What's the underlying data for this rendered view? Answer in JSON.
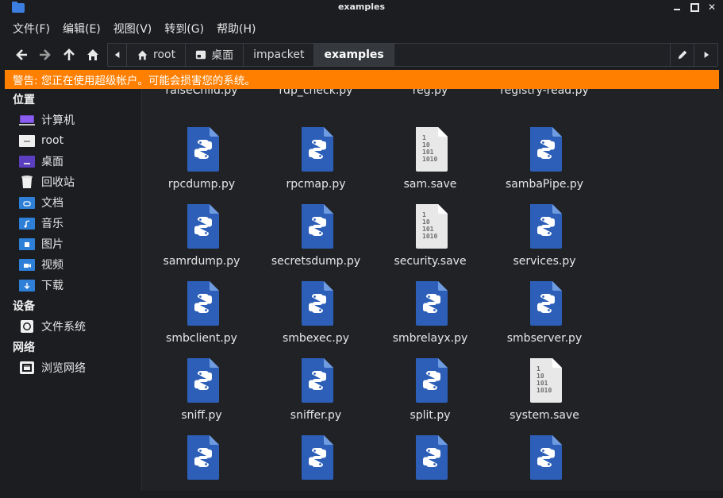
{
  "window": {
    "title": "examples"
  },
  "menu": [
    {
      "label": "文件(F)"
    },
    {
      "label": "编辑(E)"
    },
    {
      "label": "视图(V)"
    },
    {
      "label": "转到(G)"
    },
    {
      "label": "帮助(H)"
    }
  ],
  "pathbar": {
    "crumbs": [
      {
        "label": "root",
        "icon": "home-icon"
      },
      {
        "label": "桌面",
        "icon": "desktop-icon"
      },
      {
        "label": "impacket"
      },
      {
        "label": "examples",
        "active": true
      }
    ]
  },
  "warning": {
    "text": "警告: 您正在使用超级帐户。可能会损害您的系统。",
    "color": "#ff7f00"
  },
  "sidebar": {
    "sections": [
      {
        "title": "位置",
        "items": [
          {
            "label": "计算机",
            "icon": "computer-icon"
          },
          {
            "label": "root",
            "icon": "home-folder-icon"
          },
          {
            "label": "桌面",
            "icon": "desktop-folder-icon"
          },
          {
            "label": "回收站",
            "icon": "trash-icon"
          },
          {
            "label": "文档",
            "icon": "documents-folder-icon"
          },
          {
            "label": "音乐",
            "icon": "music-folder-icon"
          },
          {
            "label": "图片",
            "icon": "pictures-folder-icon"
          },
          {
            "label": "视频",
            "icon": "videos-folder-icon"
          },
          {
            "label": "下载",
            "icon": "downloads-folder-icon"
          }
        ]
      },
      {
        "title": "设备",
        "items": [
          {
            "label": "文件系统",
            "icon": "drive-icon"
          }
        ]
      },
      {
        "title": "网络",
        "items": [
          {
            "label": "浏览网络",
            "icon": "network-icon"
          }
        ]
      }
    ]
  },
  "files": {
    "rows": [
      [
        {
          "name": "raiseChild.py",
          "type": "python"
        },
        {
          "name": "rdp_check.py",
          "type": "python"
        },
        {
          "name": "reg.py",
          "type": "python"
        },
        {
          "name": "registry-read.py",
          "type": "python"
        }
      ],
      [
        {
          "name": "rpcdump.py",
          "type": "python"
        },
        {
          "name": "rpcmap.py",
          "type": "python"
        },
        {
          "name": "sam.save",
          "type": "binary"
        },
        {
          "name": "sambaPipe.py",
          "type": "python"
        }
      ],
      [
        {
          "name": "samrdump.py",
          "type": "python"
        },
        {
          "name": "secretsdump.py",
          "type": "python"
        },
        {
          "name": "security.save",
          "type": "binary"
        },
        {
          "name": "services.py",
          "type": "python"
        }
      ],
      [
        {
          "name": "smbclient.py",
          "type": "python"
        },
        {
          "name": "smbexec.py",
          "type": "python"
        },
        {
          "name": "smbrelayx.py",
          "type": "python"
        },
        {
          "name": "smbserver.py",
          "type": "python"
        }
      ],
      [
        {
          "name": "sniff.py",
          "type": "python"
        },
        {
          "name": "sniffer.py",
          "type": "python"
        },
        {
          "name": "split.py",
          "type": "python"
        },
        {
          "name": "system.save",
          "type": "binary"
        }
      ],
      [
        {
          "name": "",
          "type": "python"
        },
        {
          "name": "",
          "type": "python"
        },
        {
          "name": "",
          "type": "python"
        },
        {
          "name": "",
          "type": "python"
        }
      ]
    ],
    "binary_lines": [
      "1",
      "10",
      "101",
      "1010"
    ]
  },
  "colors": {
    "python_icon": "#2d5fb8",
    "python_fold": "#6f9be0",
    "binary_icon": "#e8e8e8",
    "accent": "#ff7f00"
  }
}
